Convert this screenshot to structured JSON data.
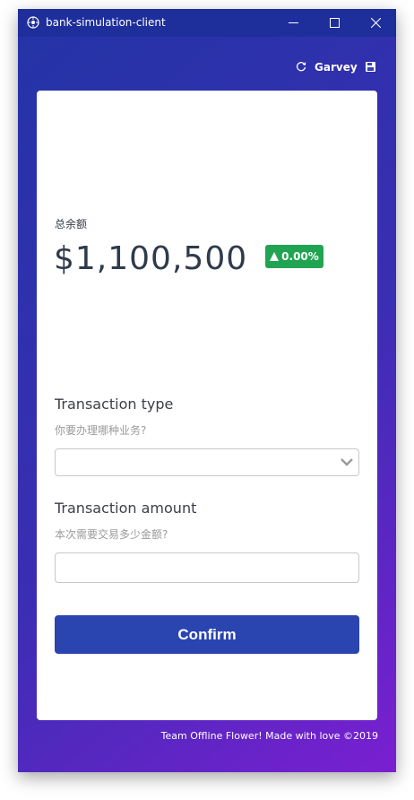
{
  "window": {
    "title": "bank-simulation-client"
  },
  "header": {
    "username": "Garvey"
  },
  "balance": {
    "label": "总余额",
    "amount": "$1,100,500",
    "change": "0.00%"
  },
  "transaction_type": {
    "title": "Transaction type",
    "subtitle": "你要办理哪种业务?",
    "selected": ""
  },
  "transaction_amount": {
    "title": "Transaction amount",
    "subtitle": "本次需要交易多少金额?",
    "value": ""
  },
  "confirm_label": "Confirm",
  "footer": "Team Offline Flower! Made with love ©2019",
  "colors": {
    "titlebar": "#1e2e9b",
    "gradient_start": "#2334a6",
    "gradient_end": "#7a1fd1",
    "badge_green": "#21a452",
    "button_blue": "#2a44b0"
  },
  "icons": [
    "app-icon",
    "minimize-icon",
    "maximize-icon",
    "close-icon",
    "refresh-icon",
    "save-icon",
    "triangle-up-icon",
    "chevron-down-icon"
  ]
}
